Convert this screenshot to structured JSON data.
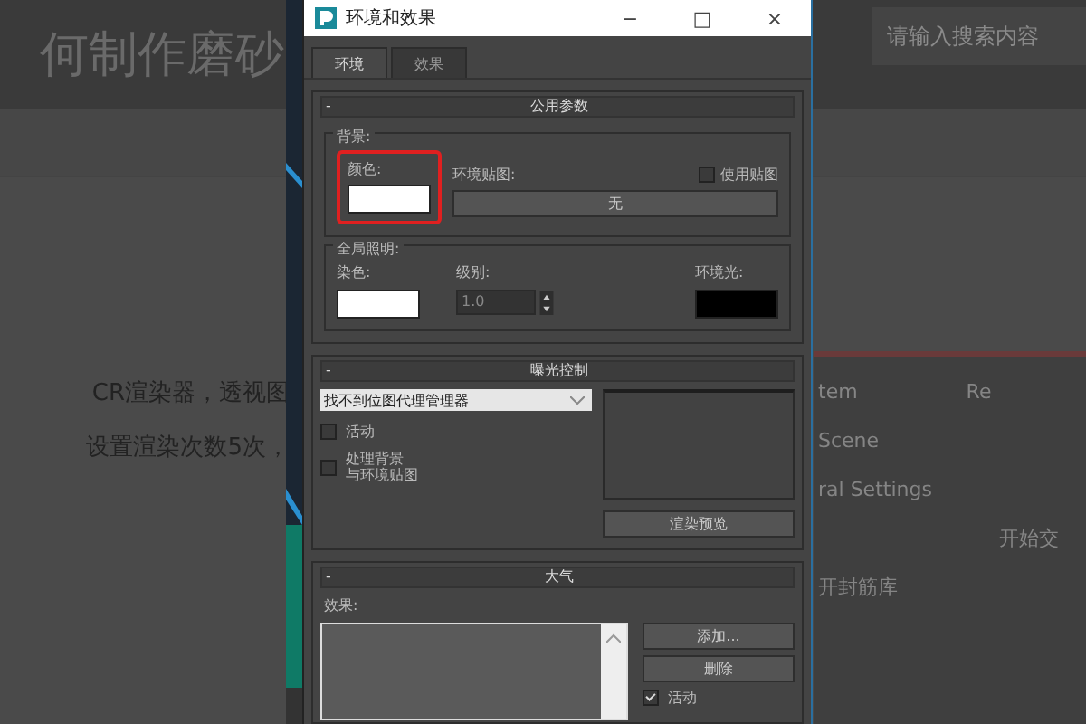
{
  "page": {
    "heading": "何制作磨砂",
    "search": {
      "placeholder": "请输入搜索内容"
    },
    "body_lines": [
      "CR渲染器，透视图",
      "设置渲染次数5次，"
    ],
    "right_items": [
      "tem",
      "Re",
      "Scene",
      "ral Settings",
      "开始交",
      "开封筋库"
    ]
  },
  "window": {
    "title": "环境和效果",
    "controls": [
      "−",
      "□",
      "×"
    ]
  },
  "tabs": [
    {
      "label": "环境",
      "selected": true
    },
    {
      "label": "效果",
      "selected": false
    }
  ],
  "common": {
    "title": "公用参数",
    "collapse": "-",
    "background": {
      "title": "背景:",
      "color_label": "颜色:",
      "highlighted": true,
      "map_label": "环境贴图:",
      "map_button": "无",
      "use_map": {
        "label": "使用贴图",
        "checked": false
      }
    },
    "lighting": {
      "title": "全局照明:",
      "tint_label": "染色:",
      "level_label": "级别:",
      "level_value": "1.0",
      "ambient_label": "环境光:"
    }
  },
  "exposure": {
    "title": "曝光控制",
    "collapse": "-",
    "dropdown": "找不到位图代理管理器",
    "active": {
      "label": "活动",
      "checked": false
    },
    "process": {
      "label_lines": [
        "处理背景",
        "与环境贴图"
      ],
      "checked": false
    },
    "preview_button": "渲染预览"
  },
  "atmosphere": {
    "title": "大气",
    "collapse": "-",
    "effects_label": "效果:",
    "add_button": "添加...",
    "delete_button": "删除",
    "active": {
      "label": "活动",
      "checked": true
    }
  }
}
